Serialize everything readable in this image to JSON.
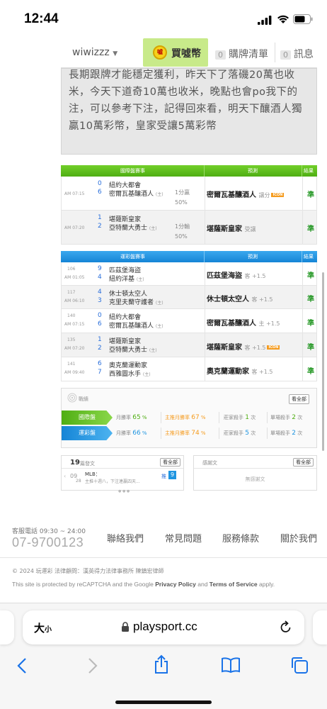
{
  "status_bar": {
    "time": "12:44"
  },
  "nav": {
    "username": "wiwizzz",
    "buy_coin": "買噓幣",
    "coin_icon_text": "噓",
    "cart_count": "0",
    "cart_label": "購牌清單",
    "msg_count": "0",
    "msg_label": "訊息"
  },
  "article": {
    "lines": [
      "長期跟牌才能穩定獲利，昨天下了落磯20萬也收",
      "米，今天下道奇10萬也收米，晚點也會po我下的",
      "注，可以參考下注，記得回來看，明天下釀酒人獨",
      "贏10萬彩幣，皇家受讓5萬彩幣"
    ]
  },
  "intl_table": {
    "header": {
      "col1": "國際盤賽事",
      "col2": "預測",
      "col3": "結果"
    },
    "colors": {
      "header_bg": "#5fbf1f"
    },
    "rows": [
      {
        "time": "AM 07:15",
        "num1": "0",
        "team1": "紐約大都會",
        "num2": "6",
        "team2": "密爾瓦基釀酒人",
        "home": "(主)",
        "extra1": "1分贏",
        "extra2": "50%",
        "pick": "密爾瓦基釀酒人",
        "pick_note": "讓分",
        "tag": "ICON",
        "result": "準"
      },
      {
        "time": "AM 07:20",
        "num1": "1",
        "team1": "堪薩斯皇家",
        "num2": "2",
        "team2": "亞特蘭大勇士",
        "home": "(主)",
        "extra1": "1分輸",
        "extra2": "50%",
        "pick": "堪薩斯皇家",
        "pick_note": "受讓",
        "tag": "",
        "result": "準"
      }
    ]
  },
  "local_table": {
    "header": {
      "col1": "運彩盤賽事",
      "col2": "預測",
      "col3": "結果"
    },
    "colors": {
      "header_bg": "#1f95e0"
    },
    "rows": [
      {
        "id": "106",
        "time": "AM 01:05",
        "num1": "9",
        "team1": "匹茲堡海盜",
        "num2": "4",
        "team2": "紐約洋基",
        "home": "(主)",
        "pick": "匹茲堡海盜",
        "pick_note": "客 +1.5",
        "tag": "",
        "result": "準"
      },
      {
        "id": "117",
        "time": "AM 06:10",
        "num1": "4",
        "team1": "休士頓太空人",
        "num2": "3",
        "team2": "克里夫蘭守護者",
        "home": "(主)",
        "pick": "休士頓太空人",
        "pick_note": "客 +1.5",
        "tag": "",
        "result": "準"
      },
      {
        "id": "140",
        "time": "AM 07:15",
        "num1": "0",
        "team1": "紐約大都會",
        "num2": "6",
        "team2": "密爾瓦基釀酒人",
        "home": "(主)",
        "pick": "密爾瓦基釀酒人",
        "pick_note": "主 +1.5",
        "tag": "",
        "result": "準"
      },
      {
        "id": "135",
        "time": "AM 07:20",
        "num1": "1",
        "team1": "堪薩斯皇家",
        "num2": "2",
        "team2": "亞特蘭大勇士",
        "home": "(主)",
        "pick": "堪薩斯皇家",
        "pick_note": "客 +1.5",
        "tag": "ICON",
        "result": "準"
      },
      {
        "id": "141",
        "time": "AM 09:40",
        "num1": "6",
        "team1": "奧克蘭運動家",
        "num2": "7",
        "team2": "西雅圖水手",
        "home": "(主)",
        "pick": "奧克蘭運動家",
        "pick_note": "客 +1.5",
        "tag": "",
        "result": "準"
      }
    ]
  },
  "record": {
    "title": "戰績",
    "all_btn": "看全部",
    "intl": {
      "label": "國際盤",
      "month_label": "月勝率",
      "month_val": "65",
      "home_label": "主推月勝率",
      "home_val": "67",
      "king_label": "莊家殺手",
      "king_val": "1",
      "king_unit": "次",
      "single_label": "單場殺手",
      "single_val": "2",
      "single_unit": "次",
      "color": "#5fbf1f"
    },
    "local": {
      "label": "運彩盤",
      "month_label": "月勝率",
      "month_val": "66",
      "home_label": "主推月勝率",
      "home_val": "74",
      "king_label": "莊家殺手",
      "king_val": "5",
      "king_unit": "次",
      "single_label": "單場殺手",
      "single_val": "2",
      "single_unit": "次",
      "color": "#1f95e0"
    }
  },
  "posts": {
    "count": "19",
    "label": "篇發文",
    "all_btn": "看全部",
    "date_top": "09",
    "date_bottom": "28",
    "line1": "MLB：",
    "line2": "主推十週八，下注連贏四天...",
    "push_label": "推",
    "push_count": "9"
  },
  "thanks": {
    "title": "感謝文",
    "all_btn": "看全部",
    "empty": "無感謝文"
  },
  "footer": {
    "service_label": "客服電話 09:30 ~ 24:00",
    "phone": "07-9700123",
    "links": [
      "聯絡我們",
      "常見問題",
      "服務條款",
      "關於我們"
    ],
    "copyright": "© 2024 玩運彩 法律顧問：漢英得力法律事務所 陳鎮宏律師",
    "recaptcha_pre": "This site is protected by reCAPTCHA and the Google ",
    "privacy": "Privacy Policy",
    "and": " and ",
    "terms": "Terms of Service",
    "apply": " apply."
  },
  "browser": {
    "text_size": "大",
    "text_size_small": "小",
    "url": "playsport.cc"
  }
}
